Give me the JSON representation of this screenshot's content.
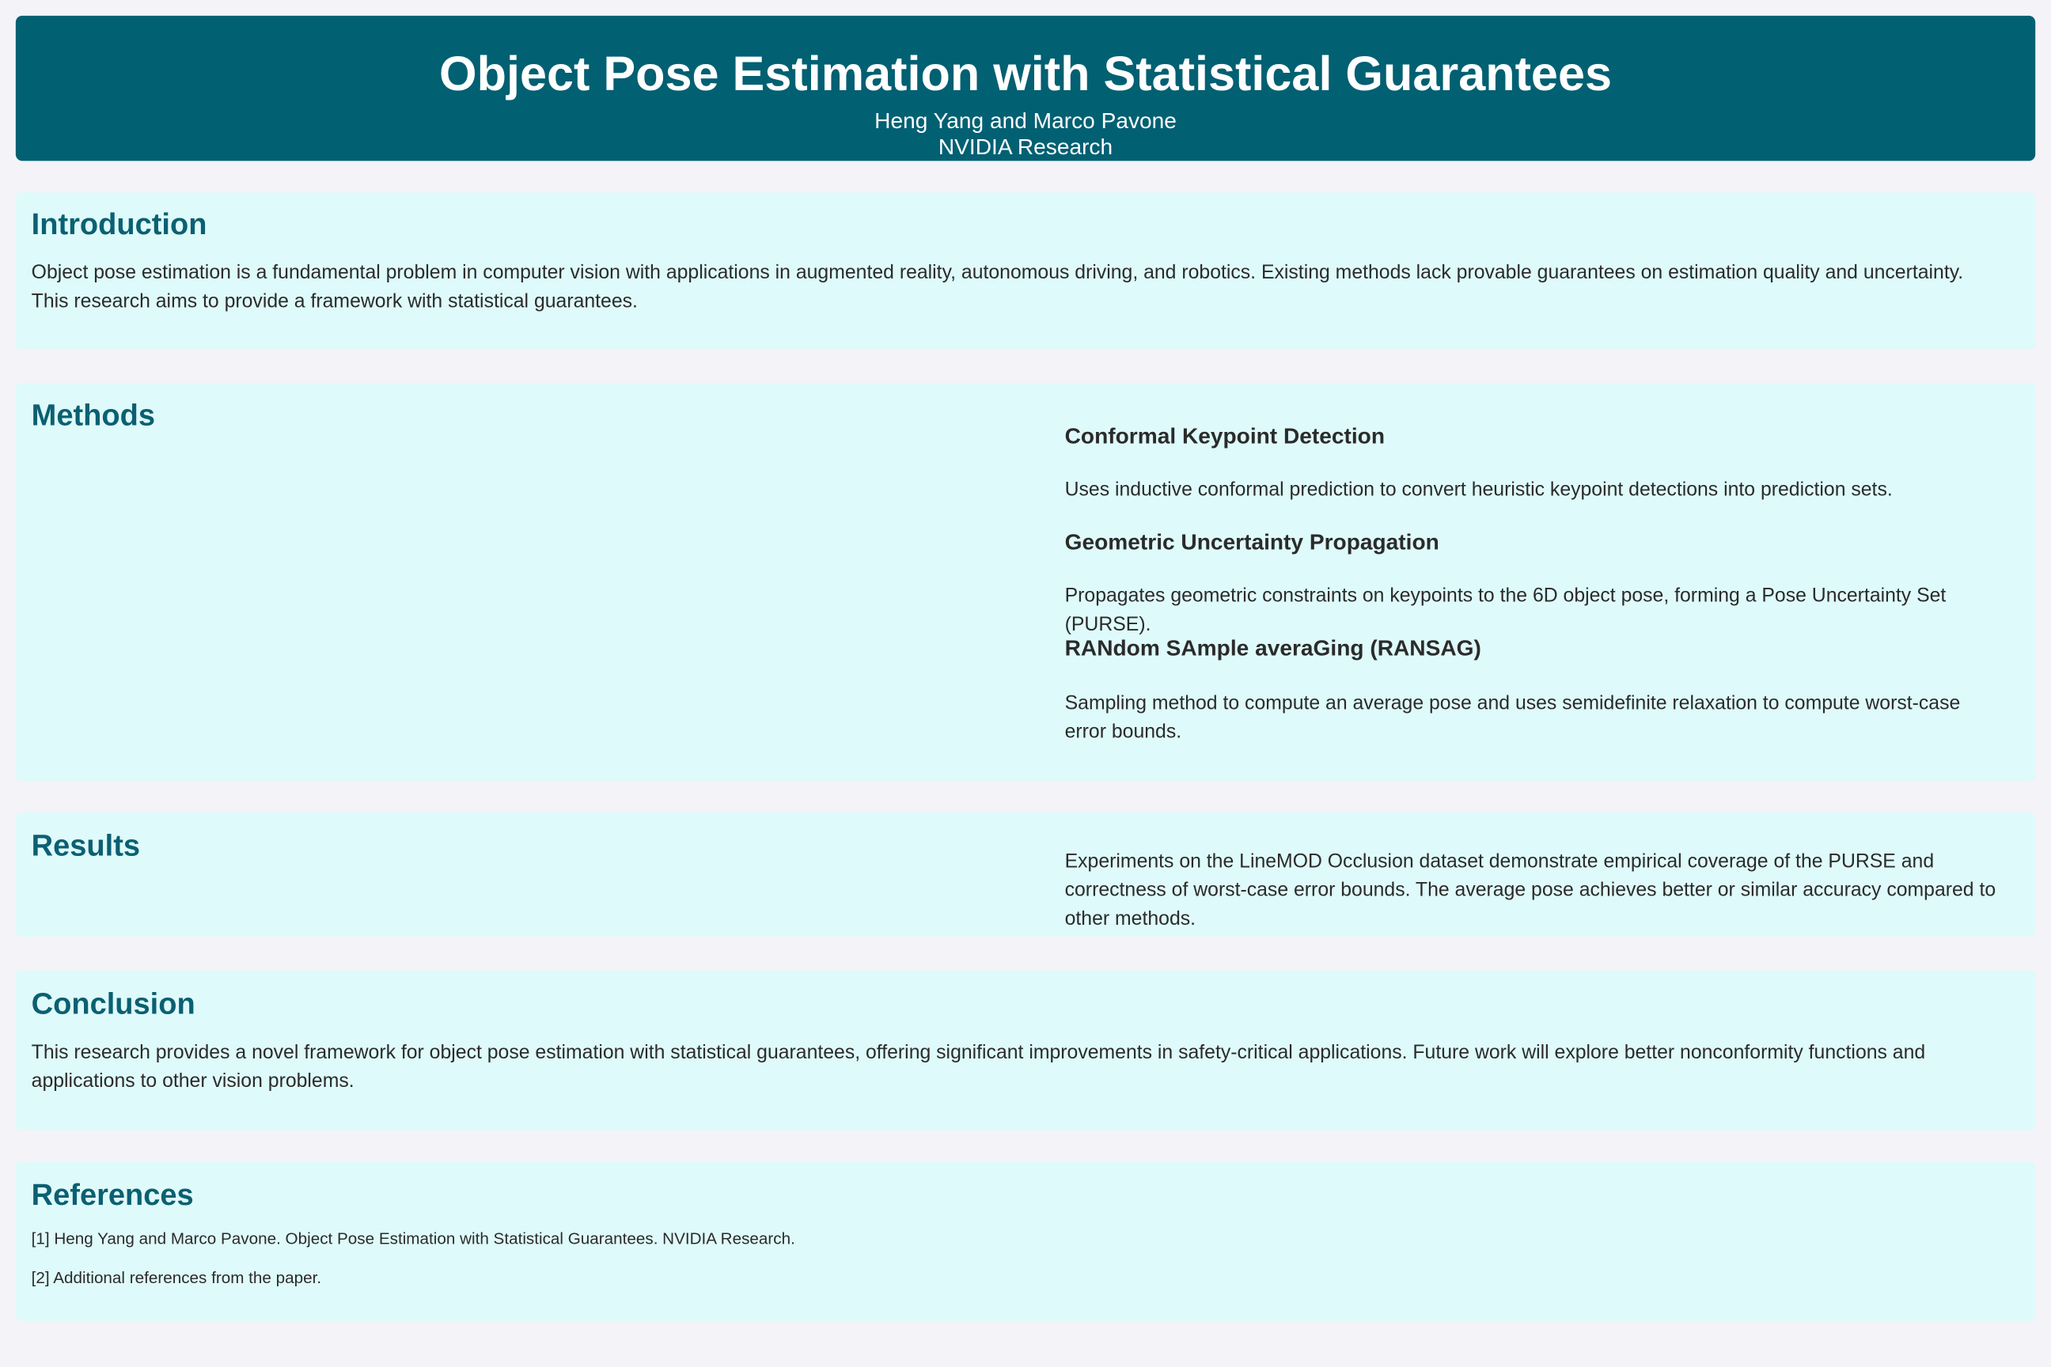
{
  "header": {
    "title": "Object Pose Estimation with Statistical Guarantees",
    "authors": "Heng Yang and Marco Pavone",
    "affiliation": "NVIDIA Research"
  },
  "introduction": {
    "heading": "Introduction",
    "text": "Object pose estimation is a fundamental problem in computer vision with applications in augmented reality, autonomous driving, and robotics. Existing methods lack provable guarantees on estimation quality and uncertainty. This research aims to provide a framework with statistical guarantees."
  },
  "methods": {
    "heading": "Methods",
    "items": [
      {
        "title": "Conformal Keypoint Detection",
        "text": "Uses inductive conformal prediction to convert heuristic keypoint detections into prediction sets."
      },
      {
        "title": "Geometric Uncertainty Propagation",
        "text": "Propagates geometric constraints on keypoints to the 6D object pose, forming a Pose Uncertainty Set (PURSE)."
      },
      {
        "title": "RANdom SAmple averaGing (RANSAG)",
        "text": "Sampling method to compute an average pose and uses semidefinite relaxation to compute worst-case error bounds."
      }
    ]
  },
  "results": {
    "heading": "Results",
    "text": "Experiments on the LineMOD Occlusion dataset demonstrate empirical coverage of the PURSE and correctness of worst-case error bounds. The average pose achieves better or similar accuracy compared to other methods."
  },
  "conclusion": {
    "heading": "Conclusion",
    "text": "This research provides a novel framework for object pose estimation with statistical guarantees, offering significant improvements in safety-critical applications. Future work will explore better nonconformity functions and applications to other vision problems."
  },
  "references": {
    "heading": "References",
    "items": [
      "[1] Heng Yang and Marco Pavone. Object Pose Estimation with Statistical Guarantees. NVIDIA Research.",
      "[2] Additional references from the paper."
    ]
  }
}
